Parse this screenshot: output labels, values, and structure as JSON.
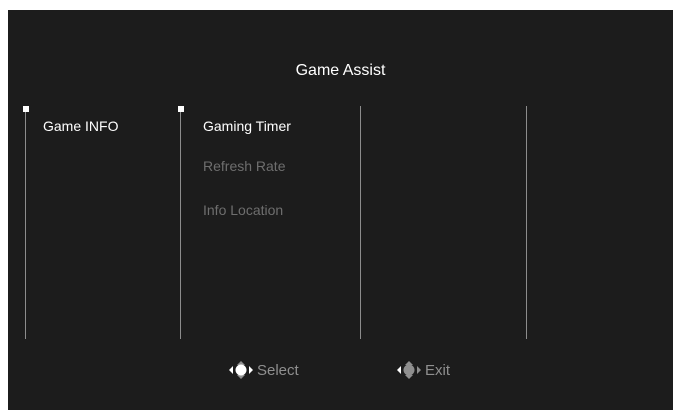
{
  "osd": {
    "title": "Game Assist",
    "level1": {
      "items": [
        {
          "label": "Game INFO",
          "state": "selected"
        }
      ]
    },
    "level2": {
      "items": [
        {
          "label": "Gaming Timer",
          "state": "selected"
        },
        {
          "label": "Refresh Rate",
          "state": "inactive"
        },
        {
          "label": "Info Location",
          "state": "inactive"
        }
      ]
    },
    "footer": {
      "select": {
        "label": "Select",
        "icon": "joystick-press-icon"
      },
      "exit": {
        "label": "Exit",
        "icon": "joystick-left-icon"
      }
    },
    "colors": {
      "background": "#1c1c1c",
      "text_active": "#ffffff",
      "text_inactive": "#6e6e6e",
      "divider": "#8c8c8c"
    }
  }
}
